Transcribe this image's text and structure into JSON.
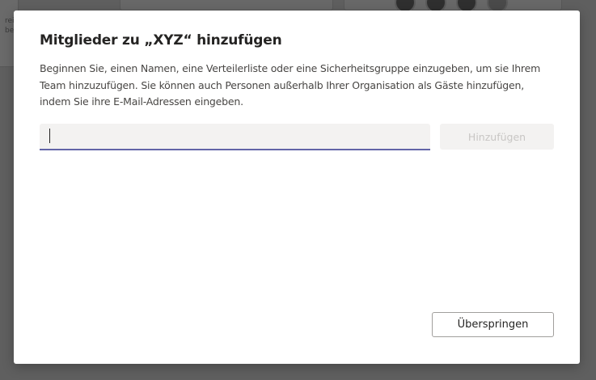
{
  "background": {
    "fragment_line1": "rei",
    "fragment_line2": "be"
  },
  "dialog": {
    "title": "Mitglieder zu „XYZ“ hinzufügen",
    "description": "Beginnen Sie, einen Namen, eine Verteilerliste oder eine Sicherheitsgruppe einzugeben, um sie Ihrem Team hinzuzufügen. Sie können auch Personen außerhalb Ihrer Organisation als Gäste hinzufügen, indem Sie ihre E-Mail-Adressen eingeben.",
    "input_value": "",
    "input_placeholder": "",
    "add_label": "Hinzufügen",
    "skip_label": "Überspringen"
  },
  "colors": {
    "accent": "#6264a7",
    "overlay": "#5f5f5f",
    "disabled_text": "#c8c6c4"
  }
}
